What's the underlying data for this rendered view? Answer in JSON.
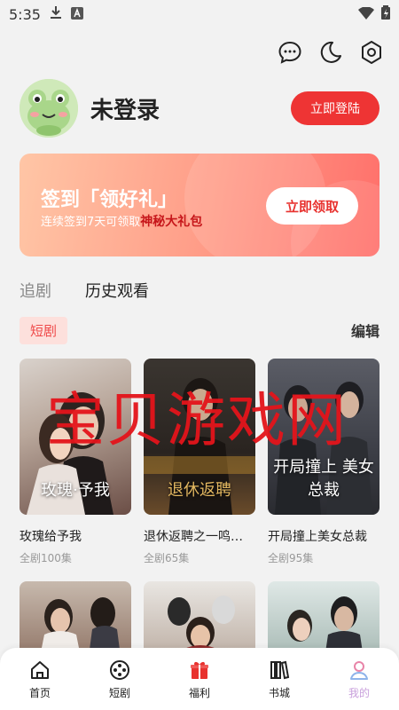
{
  "status": {
    "time": "5:35"
  },
  "profile": {
    "username": "未登录",
    "login_button": "立即登陆"
  },
  "banner": {
    "title": "签到「领好礼」",
    "subtitle_prefix": "连续签到7天可领取",
    "subtitle_highlight": "神秘大礼包",
    "button": "立即领取"
  },
  "tabs": [
    {
      "label": "追剧"
    },
    {
      "label": "历史观看"
    }
  ],
  "section": {
    "chip": "短剧",
    "edit": "编辑"
  },
  "dramas": [
    {
      "title": "玫瑰给予我",
      "episodes": "全剧100集",
      "poster_text": "玫瑰·予我"
    },
    {
      "title": "退休返聘之一鸣…",
      "episodes": "全剧65集",
      "poster_text": "退休返聘"
    },
    {
      "title": "开局撞上美女总裁",
      "episodes": "全剧95集",
      "poster_text": "开局撞上 美女总裁"
    }
  ],
  "watermark": "宝贝游戏网",
  "bottom_nav": [
    {
      "label": "首页",
      "icon": "home-icon"
    },
    {
      "label": "短剧",
      "icon": "film-reel-icon"
    },
    {
      "label": "福利",
      "icon": "gift-icon"
    },
    {
      "label": "书城",
      "icon": "books-icon"
    },
    {
      "label": "我的",
      "icon": "profile-icon"
    }
  ],
  "colors": {
    "accent": "#ee3434",
    "nav_active": "#c9a0dc"
  }
}
